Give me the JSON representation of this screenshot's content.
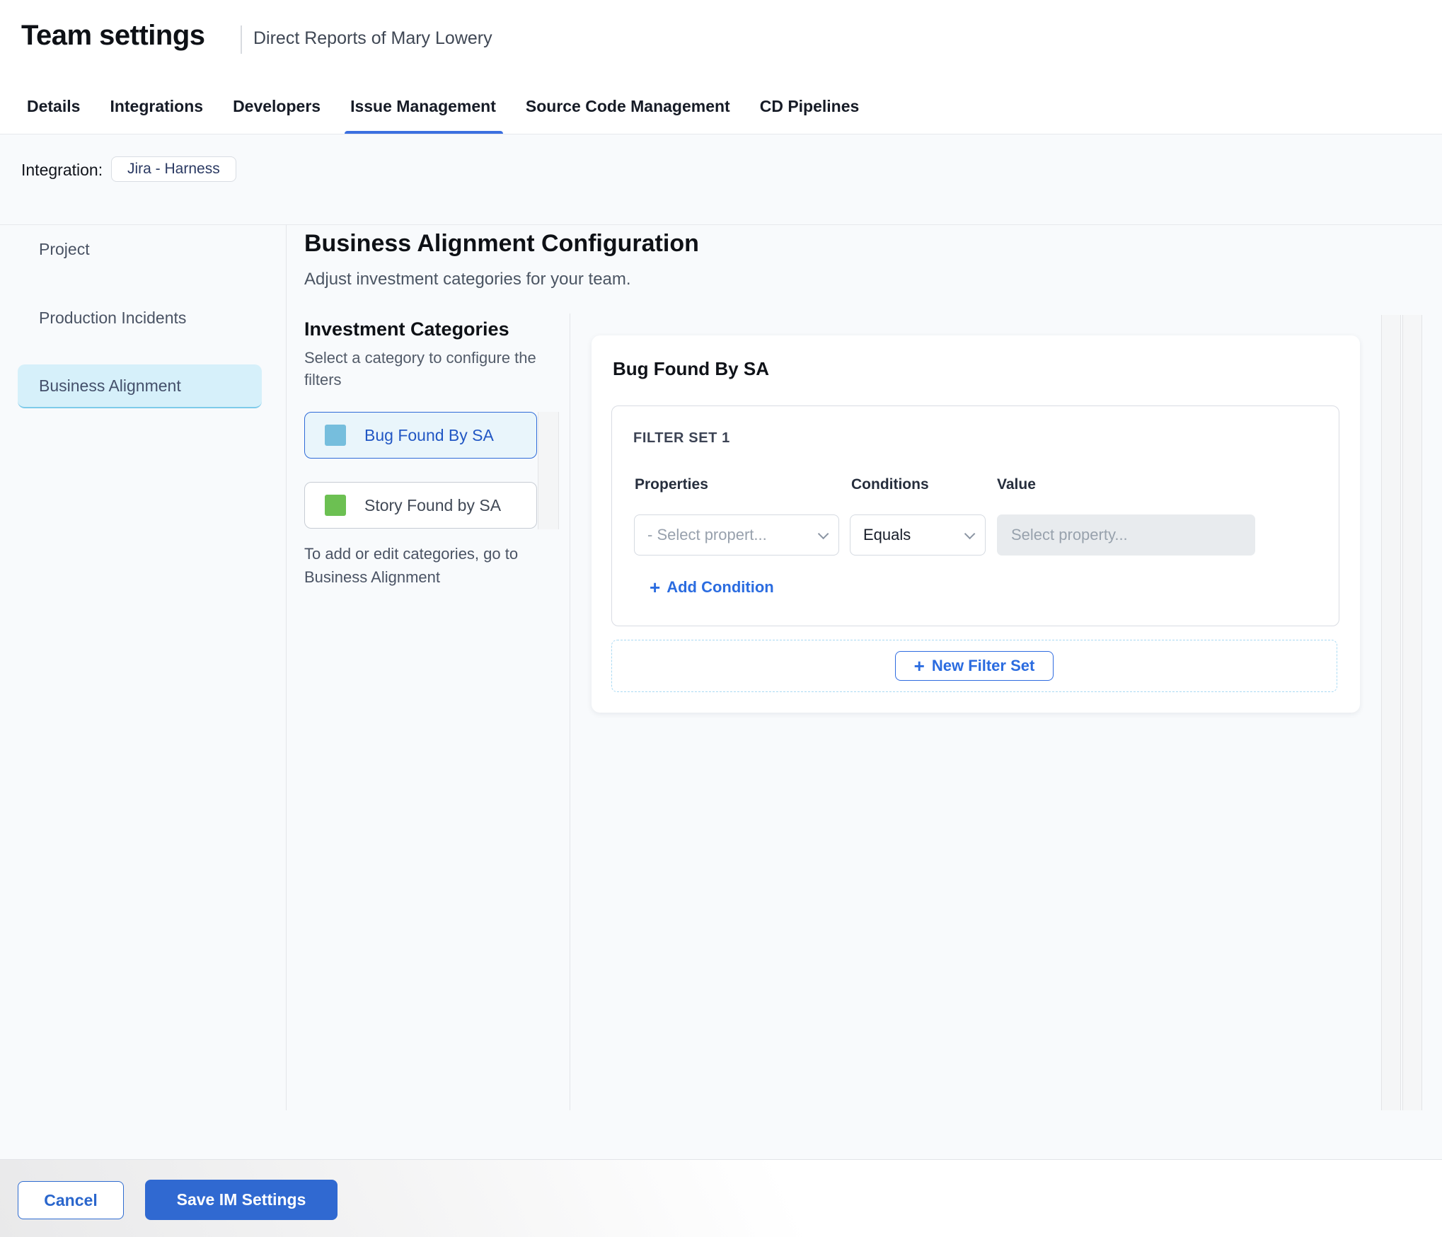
{
  "colors": {
    "accent_blue": "#2F6BD8",
    "save_button": "#3069D1",
    "tab_underline": "#3B6FE0",
    "selected_pill_bg": "#D6F0FA",
    "selected_category_bg": "#E9F5FB",
    "bug_swatch": "#76BEDD",
    "story_swatch": "#6CC052",
    "content_bg": "#F8FAFC",
    "dashed_border": "#A9DAF3"
  },
  "header": {
    "title": "Team settings",
    "subtitle": "Direct Reports of Mary Lowery"
  },
  "tabs": {
    "items": [
      {
        "label": "Details"
      },
      {
        "label": "Integrations"
      },
      {
        "label": "Developers"
      },
      {
        "label": "Issue Management",
        "active": true
      },
      {
        "label": "Source Code Management"
      },
      {
        "label": "CD Pipelines"
      }
    ]
  },
  "integration": {
    "label": "Integration:",
    "chip": "Jira - Harness"
  },
  "sidebar": {
    "items": [
      {
        "label": "Project"
      },
      {
        "label": "Production Incidents"
      },
      {
        "label": "Business Alignment",
        "selected": true
      }
    ]
  },
  "main": {
    "heading": "Business Alignment Configuration",
    "subheading": "Adjust investment categories for your team.",
    "categories": {
      "title": "Investment Categories",
      "hint_line1": "Select a category to configure the",
      "hint_line2": "filters",
      "items": [
        {
          "label": "Bug Found By SA",
          "swatch_style": "background-color:#76BEDD",
          "selected": true
        },
        {
          "label": "Story Found by SA",
          "swatch_style": "background-color:#6CC052",
          "selected": false
        }
      ],
      "footnote_line1": "To add or edit categories, go to",
      "footnote_line2": "Business Alignment"
    },
    "panel": {
      "title": "Bug Found By SA",
      "filter_set": {
        "title": "FILTER SET 1",
        "columns": [
          "Properties",
          "Conditions",
          "Value"
        ],
        "row": {
          "property_placeholder": "- Select propert...",
          "condition_value": "Equals",
          "value_placeholder": "Select property..."
        },
        "add_condition_label": "Add Condition"
      },
      "new_filter_set_label": "New Filter Set"
    }
  },
  "icons": {
    "plus": "+"
  },
  "footer": {
    "cancel_label": "Cancel",
    "save_label": "Save IM Settings"
  }
}
